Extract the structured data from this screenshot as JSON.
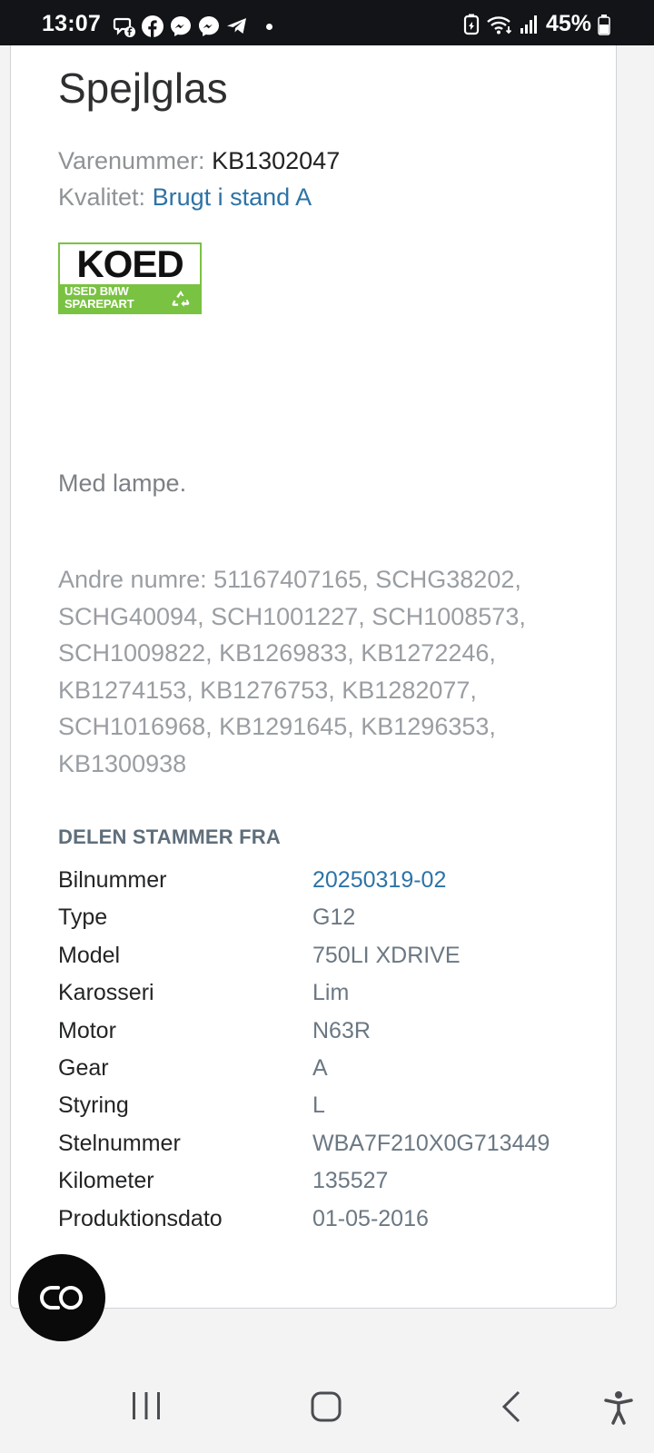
{
  "status_bar": {
    "time": "13:07",
    "notification_icons": [
      "messenger-chat-icon",
      "facebook-icon",
      "messenger-icon",
      "messenger-icon",
      "telegram-icon"
    ],
    "battery_percent": "45%"
  },
  "product": {
    "title": "Spejlglas",
    "sku_label": "Varenummer:",
    "sku_value": "KB1302047",
    "quality_label": "Kvalitet:",
    "quality_value": "Brugt i stand A",
    "logo_text_main": "KOED",
    "logo_text_line1": "USED BMW",
    "logo_text_line2": "SPAREPART",
    "description": "Med lampe.",
    "other_numbers": "Andre numre: 51167407165, SCHG38202, SCHG40094, SCH1001227, SCH1008573, SCH1009822, KB1269833, KB1272246, KB1274153, KB1276753, KB1282077, SCH1016968, KB1291645, KB1296353, KB1300938"
  },
  "origin": {
    "heading": "DELEN STAMMER FRA",
    "rows": [
      {
        "label": "Bilnummer",
        "value": "20250319-02"
      },
      {
        "label": "Type",
        "value": "G12"
      },
      {
        "label": "Model",
        "value": "750LI XDRIVE"
      },
      {
        "label": "Karosseri",
        "value": "Lim"
      },
      {
        "label": "Motor",
        "value": "N63R"
      },
      {
        "label": "Gear",
        "value": "A"
      },
      {
        "label": "Styring",
        "value": "L"
      },
      {
        "label": "Stelnummer",
        "value": "WBA7F210X0G713449"
      },
      {
        "label": "Kilometer",
        "value": "135527"
      },
      {
        "label": "Produktionsdato",
        "value": "01-05-2016"
      }
    ]
  },
  "colors": {
    "link": "#2d73a6",
    "logo_green": "#7ac242",
    "status_bar_bg": "#121418"
  },
  "navbar": {
    "buttons": [
      "recent-apps-icon",
      "home-icon",
      "back-icon",
      "accessibility-icon"
    ]
  }
}
